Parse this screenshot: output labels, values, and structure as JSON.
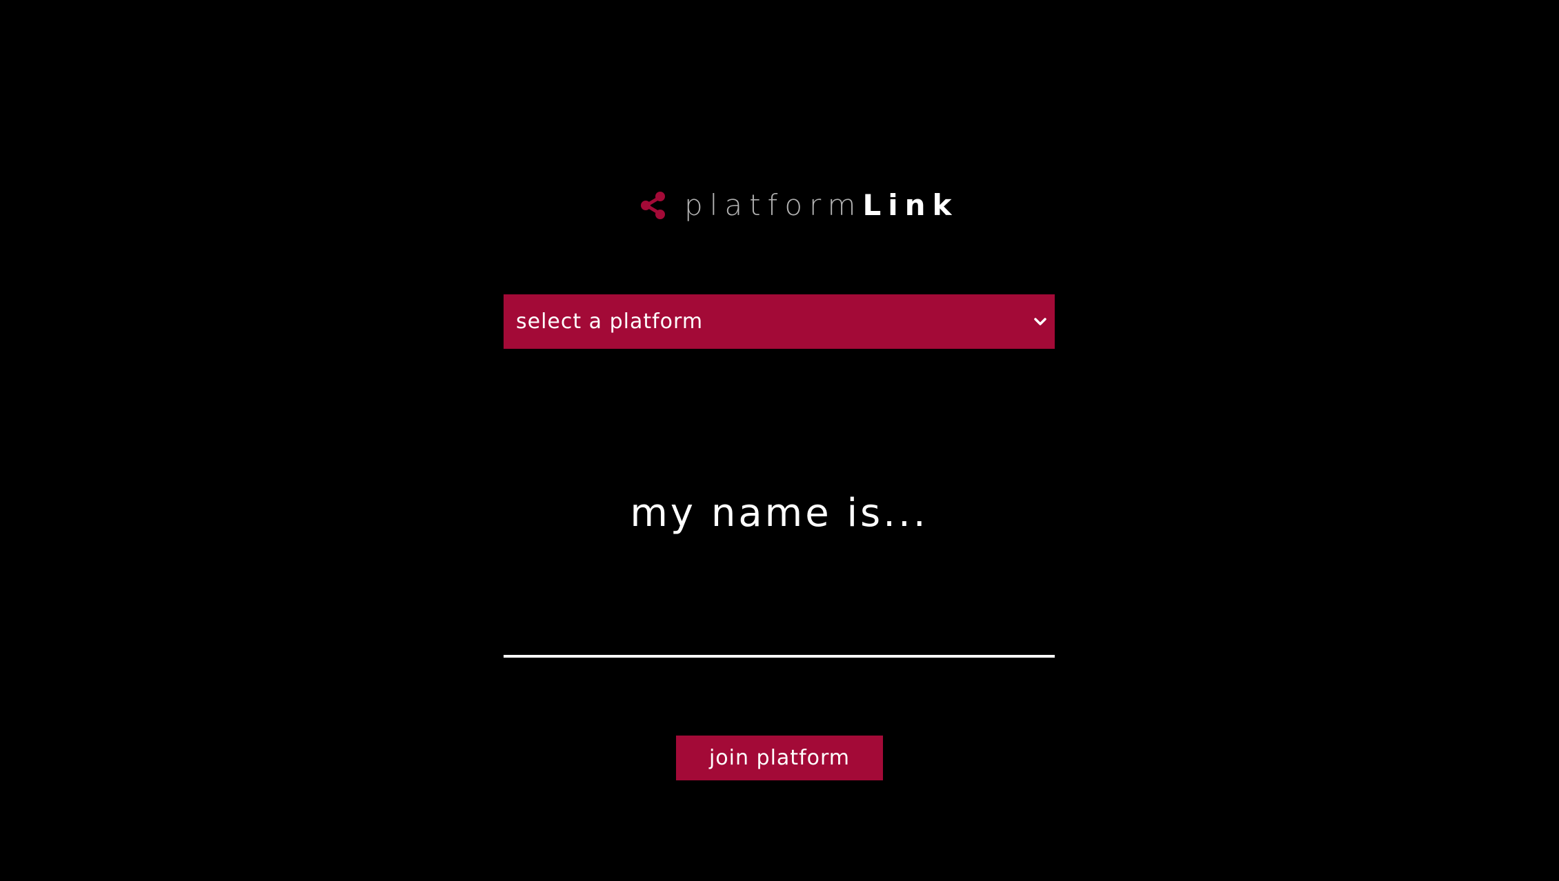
{
  "brand": {
    "icon": "share-icon",
    "name_light": "platform",
    "name_bold": "Link",
    "accent_color": "#a30a37",
    "light_text_color": "#b3b3b3"
  },
  "platform_select": {
    "selected_label": "select a platform",
    "icon": "chevron-down-icon"
  },
  "name_prompt": {
    "label": "my name is...",
    "input_value": ""
  },
  "join_button": {
    "label": "join platform"
  }
}
